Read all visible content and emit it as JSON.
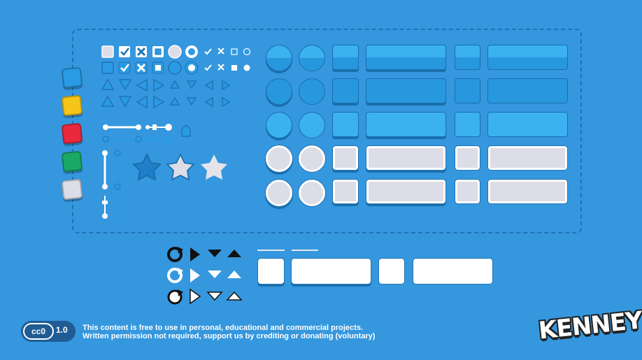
{
  "license": {
    "badge_label": "cc0",
    "version": "1.0",
    "line1": "This content is free to use in personal, educational and commercial projects.",
    "line2": "Written permission not required, support us by crediting or donating (voluntary)"
  },
  "brand": {
    "logo_text": "KENNEY"
  },
  "colors": {
    "background": "#3597de",
    "swatch_blue": "#2a9ae4",
    "swatch_yellow": "#f5c518",
    "swatch_red": "#e9283e",
    "swatch_green": "#1aa866",
    "swatch_grey": "#dcdde6"
  },
  "icons": {
    "swatches": [
      "blue-swatch",
      "yellow-swatch",
      "red-swatch",
      "green-swatch",
      "grey-swatch"
    ],
    "checkbox_row": [
      "checkbox-empty-icon",
      "checkbox-checked-icon",
      "checkbox-cross-icon",
      "checkbox-square-icon",
      "radio-empty-icon",
      "radio-filled-icon",
      "check-small-icon",
      "cross-small-icon",
      "square-small-icon",
      "circle-small-icon"
    ],
    "arrow_row": [
      "arrow-up-icon",
      "arrow-down-icon",
      "arrow-left-icon",
      "arrow-right-icon",
      "arrow-up-small-icon",
      "arrow-down-small-icon",
      "arrow-left-small-icon",
      "arrow-right-small-icon"
    ],
    "stars": [
      "star-blue-icon",
      "star-grey-icon",
      "star-grey-light-icon"
    ],
    "bottom_icons": [
      "refresh-icon",
      "play-icon",
      "triangle-down-icon",
      "triangle-up-icon"
    ]
  }
}
